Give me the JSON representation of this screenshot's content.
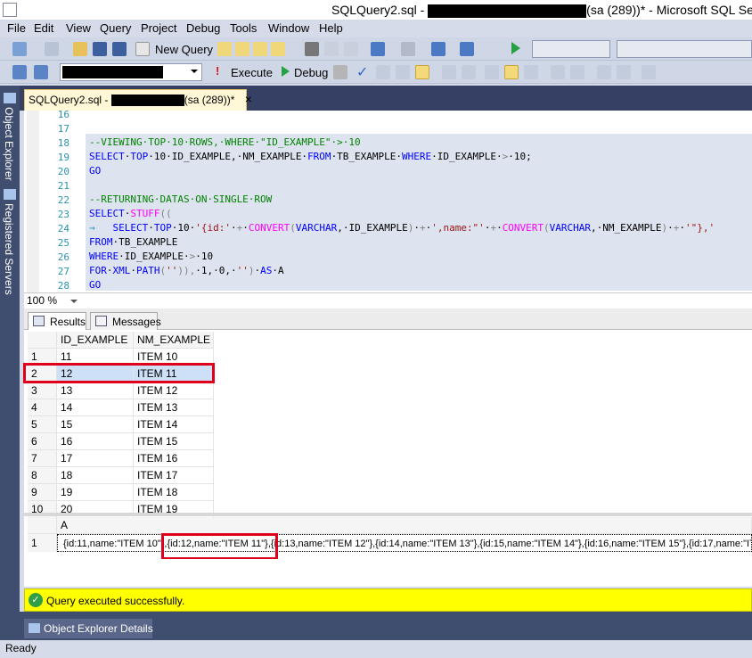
{
  "window": {
    "title_prefix": "SQLQuery2.sql - ",
    "title_suffix": "(sa (289))* - Microsoft SQL Serv"
  },
  "menu": [
    "File",
    "Edit",
    "View",
    "Query",
    "Project",
    "Debug",
    "Tools",
    "Window",
    "Help"
  ],
  "toolbar": {
    "new_query": "New Query",
    "execute": "Execute",
    "debug": "Debug"
  },
  "sidebar": {
    "object_explorer": "Object Explorer",
    "registered_servers": "Registered Servers"
  },
  "doc_tab": {
    "prefix": "SQLQuery2.sql - ",
    "suffix": "(sa (289))*",
    "close": "×"
  },
  "editor": {
    "lines": [
      {
        "n": "16"
      },
      {
        "n": "17"
      },
      {
        "n": "18"
      },
      {
        "n": "19"
      },
      {
        "n": "20"
      },
      {
        "n": "21"
      },
      {
        "n": "22"
      },
      {
        "n": "23"
      },
      {
        "n": "24"
      },
      {
        "n": "25"
      },
      {
        "n": "26"
      },
      {
        "n": "27"
      },
      {
        "n": "28"
      }
    ],
    "zoom": "100 %"
  },
  "results_tabs": {
    "results": "Results",
    "messages": "Messages"
  },
  "grid1": {
    "headers": [
      "ID_EXAMPLE",
      "NM_EXAMPLE"
    ],
    "rows": [
      [
        "1",
        "11",
        "ITEM 10"
      ],
      [
        "2",
        "12",
        "ITEM 11"
      ],
      [
        "3",
        "13",
        "ITEM 12"
      ],
      [
        "4",
        "14",
        "ITEM 13"
      ],
      [
        "5",
        "15",
        "ITEM 14"
      ],
      [
        "6",
        "16",
        "ITEM 15"
      ],
      [
        "7",
        "17",
        "ITEM 16"
      ],
      [
        "8",
        "18",
        "ITEM 17"
      ],
      [
        "9",
        "19",
        "ITEM 18"
      ],
      [
        "10",
        "20",
        "ITEM 19"
      ]
    ]
  },
  "grid2": {
    "header": "A",
    "row_num": "1",
    "seg1": "{id:11,name:\"ITEM 10\"},",
    "seg2": "{id:12,name:\"ITEM 11\"},",
    "seg3": "{id:13,name:\"ITEM 12\"},{id:14,name:\"ITEM 13\"},{id:15,name:\"ITEM 14\"},{id:16,name:\"ITEM 15\"},{id:17,name:\"IT"
  },
  "status": {
    "query": "Query executed successfully.",
    "ready": "Ready"
  },
  "bottom_tab": "Object Explorer Details",
  "colors": {
    "highlight": "#e0001b",
    "status_bg": "#ffff00",
    "accent": "#3f4d6f"
  }
}
